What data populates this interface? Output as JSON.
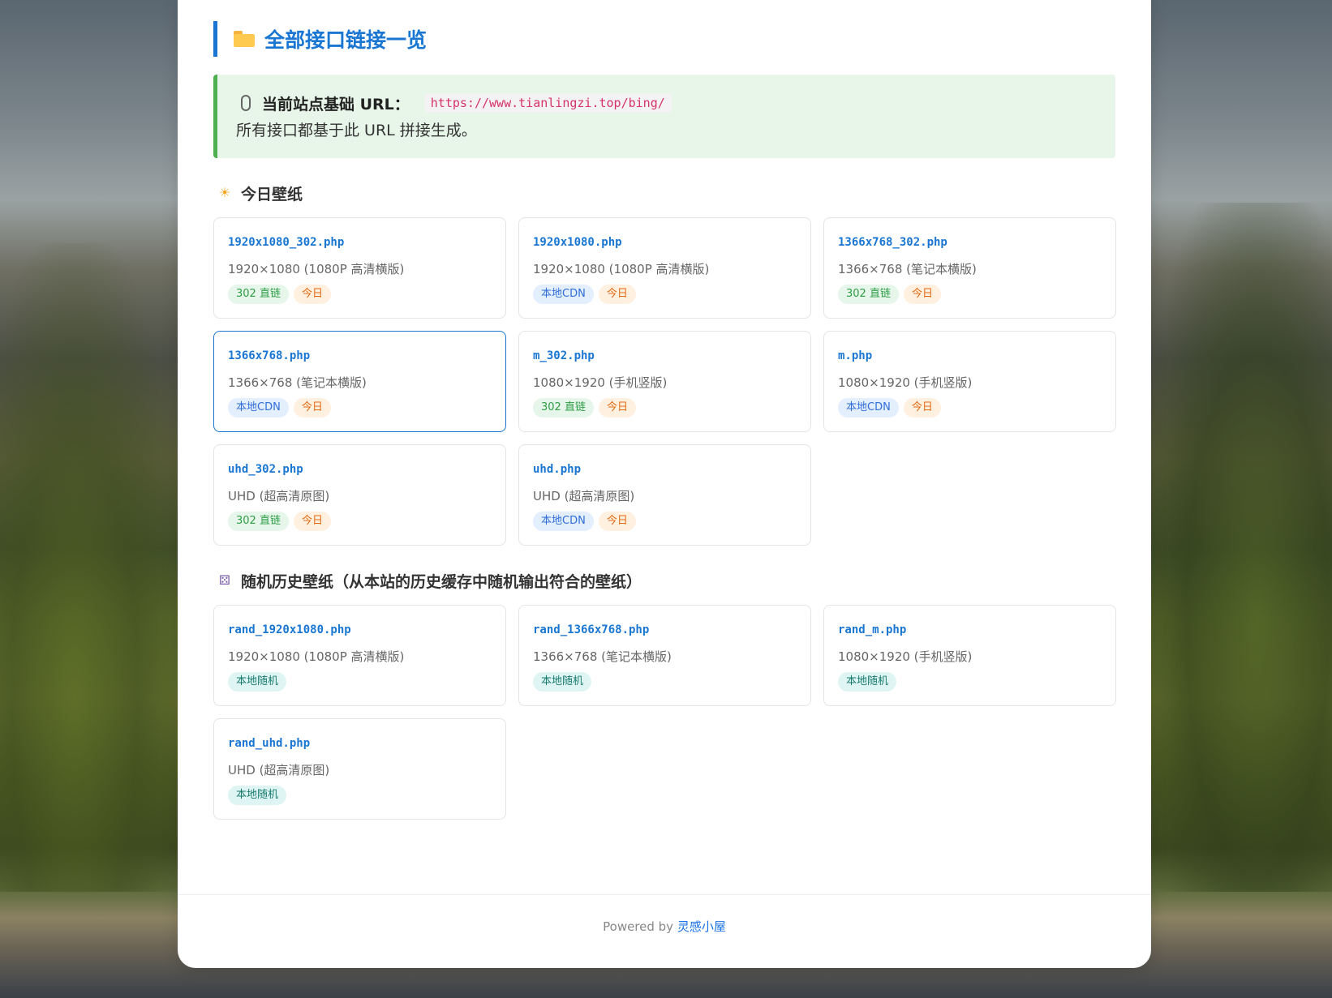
{
  "page": {
    "title": "全部接口链接一览",
    "folder_icon": "folder-icon"
  },
  "info": {
    "label": "当前站点基础 URL：",
    "url": "https://www.tianlingzi.top/bing/",
    "note": "所有接口都基于此 URL 拼接生成。"
  },
  "sections": {
    "today": {
      "title": "今日壁纸",
      "cards": [
        {
          "file": "1920x1080_302.php",
          "desc": "1920×1080 (1080P 高清横版)",
          "tags": [
            "302 直链",
            "今日"
          ]
        },
        {
          "file": "1920x1080.php",
          "desc": "1920×1080 (1080P 高清横版)",
          "tags": [
            "本地CDN",
            "今日"
          ]
        },
        {
          "file": "1366x768_302.php",
          "desc": "1366×768 (笔记本横版)",
          "tags": [
            "302 直链",
            "今日"
          ]
        },
        {
          "file": "1366x768.php",
          "desc": "1366×768 (笔记本横版)",
          "tags": [
            "本地CDN",
            "今日"
          ]
        },
        {
          "file": "m_302.php",
          "desc": "1080×1920 (手机竖版)",
          "tags": [
            "302 直链",
            "今日"
          ]
        },
        {
          "file": "m.php",
          "desc": "1080×1920 (手机竖版)",
          "tags": [
            "本地CDN",
            "今日"
          ]
        },
        {
          "file": "uhd_302.php",
          "desc": "UHD (超高清原图)",
          "tags": [
            "302 直链",
            "今日"
          ]
        },
        {
          "file": "uhd.php",
          "desc": "UHD (超高清原图)",
          "tags": [
            "本地CDN",
            "今日"
          ]
        }
      ]
    },
    "random": {
      "title": "随机历史壁纸（从本站的历史缓存中随机输出符合的壁纸）",
      "cards": [
        {
          "file": "rand_1920x1080.php",
          "desc": "1920×1080 (1080P 高清横版)",
          "tags": [
            "本地随机"
          ]
        },
        {
          "file": "rand_1366x768.php",
          "desc": "1366×768 (笔记本横版)",
          "tags": [
            "本地随机"
          ]
        },
        {
          "file": "rand_m.php",
          "desc": "1080×1920 (手机竖版)",
          "tags": [
            "本地随机"
          ]
        },
        {
          "file": "rand_uhd.php",
          "desc": "UHD (超高清原图)",
          "tags": [
            "本地随机"
          ]
        }
      ]
    }
  },
  "footer": {
    "prefix": "Powered by ",
    "link": "灵感小屋"
  },
  "colors": {
    "accent": "#1976d2",
    "info_bg": "#e8f5e9",
    "info_border": "#4caf50"
  }
}
